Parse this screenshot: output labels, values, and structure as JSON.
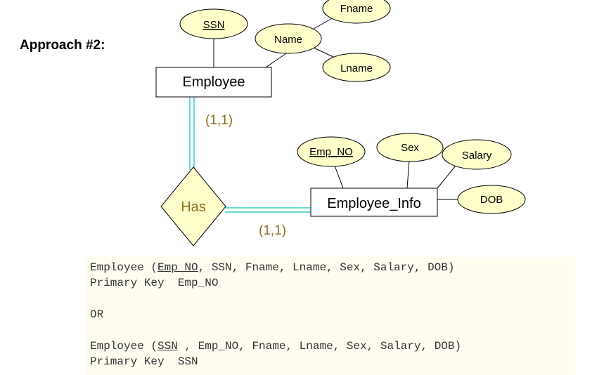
{
  "heading": "Approach #2:",
  "diagram": {
    "entities": {
      "employee": "Employee",
      "employee_info": "Employee_Info"
    },
    "relationship": "Has",
    "cardinalities": {
      "employee_side": "(1,1)",
      "info_side": "(1,1)"
    },
    "attributes": {
      "ssn": "SSN",
      "name": "Name",
      "fname": "Fname",
      "lname": "Lname",
      "emp_no": "Emp_NO",
      "sex": "Sex",
      "salary": "Salary",
      "dob": "DOB"
    },
    "colors": {
      "attribute_fill": "#ffffcc",
      "relationship_fill": "#ffffcc",
      "participation_line": "#33cccc",
      "cardinality_text": "#8a6d1d"
    }
  },
  "schema": {
    "option1": {
      "prefix": "Employee (",
      "key": "Emp_NO",
      "rest": ", SSN, Fname, Lname, Sex, Salary, DOB)",
      "pk_line": "Primary Key  Emp_NO"
    },
    "separator": "OR",
    "option2": {
      "prefix": "Employee (",
      "key": "SSN",
      "rest": " , Emp_NO, Fname, Lname, Sex, Salary, DOB)",
      "pk_line": "Primary Key  SSN"
    }
  }
}
